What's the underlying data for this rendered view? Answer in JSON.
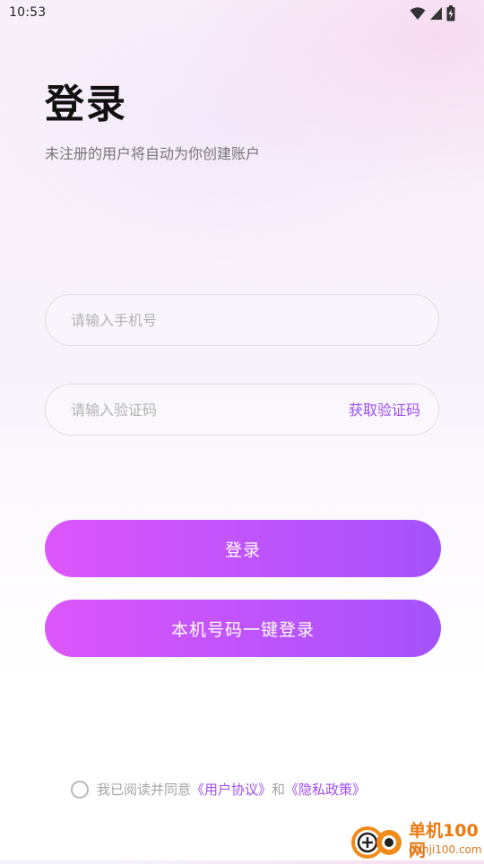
{
  "status_bar": {
    "time": "10:53",
    "icons": [
      "wifi-icon",
      "cellular-signal-icon",
      "battery-charging-icon"
    ]
  },
  "header": {
    "title": "登录",
    "subtitle": "未注册的用户将自动为你创建账户"
  },
  "form": {
    "phone_placeholder": "请输入手机号",
    "phone_value": "",
    "code_placeholder": "请输入验证码",
    "code_value": "",
    "get_code_label": "获取验证码"
  },
  "buttons": {
    "login_label": "登录",
    "onekey_label": "本机号码一键登录"
  },
  "agreement": {
    "checked": false,
    "prefix": "我已阅读并同意",
    "user_agreement": "《用户协议》",
    "conjunction": "和",
    "privacy_policy": "《隐私政策》"
  },
  "watermark": {
    "brand": "单机100网",
    "url": "danji100.com"
  },
  "colors": {
    "accent": "#a14df0",
    "button_gradient_start": "#dc56fb",
    "button_gradient_end": "#a452fb",
    "watermark": "#ea7a10"
  }
}
